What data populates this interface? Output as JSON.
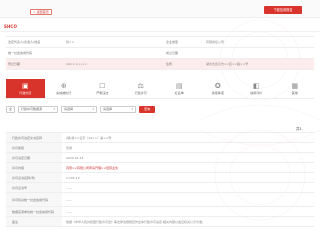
{
  "header": {
    "small_button_label": "< 返回首页",
    "apply_button_label": "下载信用报告"
  },
  "brand": {
    "name": "SHCO"
  },
  "info": {
    "rows": [
      {
        "label": "法定代表人(负责人)姓名",
        "value": "张××",
        "label2": "企业类型",
        "value2": "有限责任公司"
      },
      {
        "label": "统一社会信用代码",
        "value": "",
        "label2": "成立日期",
        "value2": ""
      },
      {
        "label": "登记日期",
        "value": "19××-××-××",
        "label2": "住所",
        "value2": "湖北省武汉市××区××路××号"
      }
    ]
  },
  "tabs": [
    {
      "icon": "building-icon",
      "glyph": "▣",
      "label": "行政处罚"
    },
    {
      "icon": "cart-icon",
      "glyph": "⊕",
      "label": "失信被执行"
    },
    {
      "icon": "clipboard-icon",
      "glyph": "☐",
      "label": "严重违法"
    },
    {
      "icon": "scale-icon",
      "glyph": "⚖",
      "label": "行政许可"
    },
    {
      "icon": "document-icon",
      "glyph": "▤",
      "label": "红名单"
    },
    {
      "icon": "certificate-icon",
      "glyph": "✪",
      "label": "信用承诺"
    },
    {
      "icon": "chart-icon",
      "glyph": "◧",
      "label": "信用评价"
    },
    {
      "icon": "grid-icon",
      "glyph": "▦",
      "label": "其他"
    }
  ],
  "filters": {
    "f1": "全",
    "f2": "行政许可数据源",
    "f3": "请选择",
    "f4": "请选择",
    "search": "查询"
  },
  "pager": {
    "text": "共1"
  },
  "detail": {
    "rows": [
      {
        "label": "行政许可决定文书名称",
        "value": "(鄂)新××证字〔20××〕第××号",
        "red": false,
        "tall": false
      },
      {
        "label": "许可类别",
        "value": "普通",
        "red": false,
        "tall": false
      },
      {
        "label": "许可决定日期",
        "value": "2020-01-13",
        "red": false,
        "tall": false
      },
      {
        "label": "许可内容",
        "value": "同意××有限公司申请开展××经营业务",
        "red": true,
        "tall": false
      },
      {
        "label": "许可证书名称(号)",
        "value": "3,795-19",
        "red": false,
        "tall": false
      },
      {
        "label": "许可证书号",
        "value": "——",
        "red": false,
        "tall": false
      },
      {
        "label": "许可机关统一社会信用代码",
        "value": "——",
        "red": false,
        "tall": true
      },
      {
        "label": "数据来源单位统一社会信用代码",
        "value": "——",
        "red": false,
        "tall": false
      },
      {
        "label": "备注",
        "value": "依据《中华人民共和国行政许可法》等法律法规规定作出本行政许可决定,相关内容以发证机关公示为准。",
        "red": false,
        "tall": false
      }
    ]
  }
}
